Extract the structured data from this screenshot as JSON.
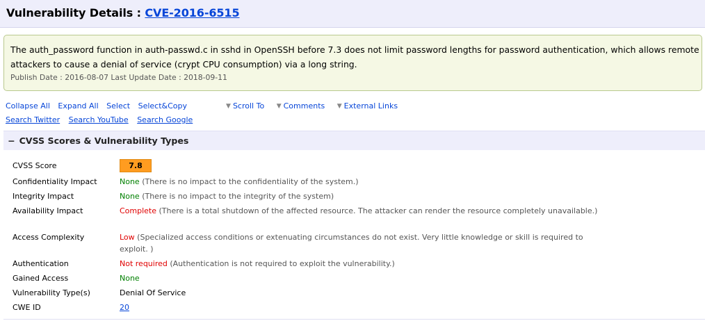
{
  "header": {
    "title_prefix": "Vulnerability Details : ",
    "cve_id": "CVE-2016-6515"
  },
  "summary": {
    "description_line1": "The auth_password function in auth-passwd.c in sshd in OpenSSH before 7.3 does not limit password lengths for password authentication, which allows remote",
    "description_line2": "attackers to cause a denial of service (crypt CPU consumption) via a long string.",
    "dates": "Publish Date : 2016-08-07 Last Update Date : 2018-09-11"
  },
  "toolbar": {
    "collapse_all": "Collapse All",
    "expand_all": "Expand All",
    "select": "Select",
    "select_copy": "Select&Copy",
    "scroll_to": "Scroll To",
    "comments": "Comments",
    "external_links": "External Links",
    "search_twitter": "Search Twitter",
    "search_youtube": "Search YouTube",
    "search_google": "Search Google",
    "caret_glyph": "▼"
  },
  "section": {
    "toggle": "−",
    "title": "CVSS Scores & Vulnerability Types"
  },
  "details": {
    "cvss_score": {
      "label": "CVSS Score",
      "value": "7.8",
      "badge_color": "#ff9c20"
    },
    "confidentiality": {
      "label": "Confidentiality Impact",
      "value": "None",
      "note": " (There is no impact to the confidentiality of the system.)"
    },
    "integrity": {
      "label": "Integrity Impact",
      "value": "None",
      "note": " (There is no impact to the integrity of the system)"
    },
    "availability": {
      "label": "Availability Impact",
      "value": "Complete",
      "note": " (There is a total shutdown of the affected resource. The attacker can render the resource completely unavailable.)"
    },
    "access_complexity": {
      "label": "Access Complexity",
      "value": "Low",
      "note": " (Specialized access conditions or extenuating circumstances do not exist. Very little knowledge or skill is required to exploit. )"
    },
    "authentication": {
      "label": "Authentication",
      "value": "Not required",
      "note": " (Authentication is not required to exploit the vulnerability.)"
    },
    "gained_access": {
      "label": "Gained Access",
      "value": "None"
    },
    "vuln_types": {
      "label": "Vulnerability Type(s)",
      "value": "Denial Of Service"
    },
    "cwe_id": {
      "label": "CWE ID",
      "value": "20"
    }
  },
  "colors": {
    "link": "#0645d8",
    "good": "#008000",
    "bad": "#e00000",
    "header_bg": "#eeeefb",
    "summary_bg": "#f5f8e4"
  }
}
